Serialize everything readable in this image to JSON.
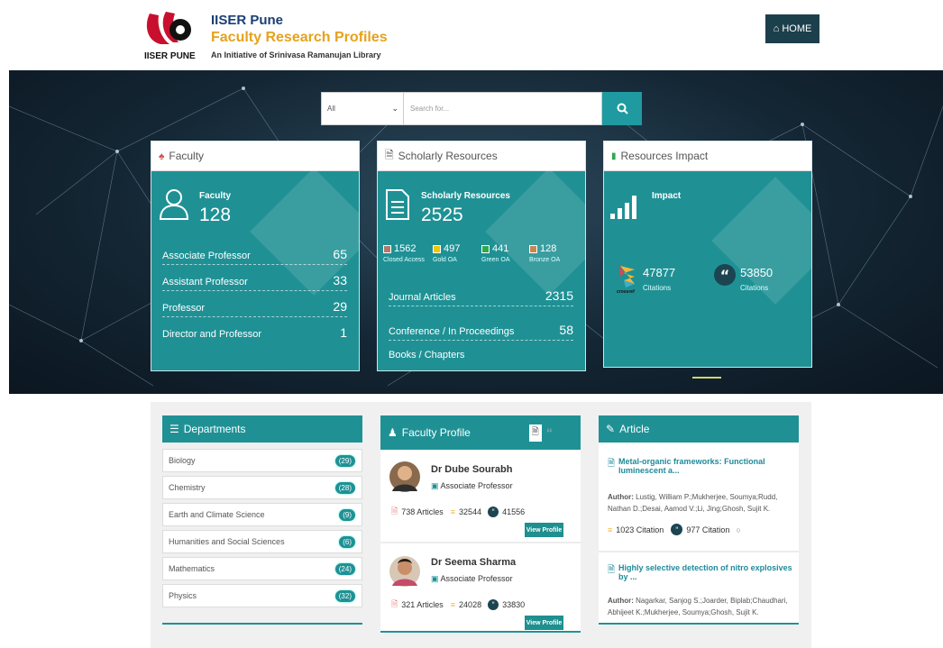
{
  "header": {
    "brand_line1": "IISER Pune",
    "brand_line2": "Faculty Research Profiles",
    "brand_line3": "An Initiative of Srinivasa Ramanujan Library",
    "logo_text": "IISER PUNE",
    "home_label": "HOME"
  },
  "search": {
    "select_value": "All",
    "placeholder": "Search for..."
  },
  "cards": {
    "faculty": {
      "header": "Faculty",
      "title": "Faculty",
      "count": "128",
      "rows": [
        {
          "label": "Associate Professor",
          "value": "65"
        },
        {
          "label": "Assistant Professor",
          "value": "33"
        },
        {
          "label": "Professor",
          "value": "29"
        },
        {
          "label": "Director and Professor",
          "value": "1"
        }
      ]
    },
    "scholarly": {
      "header": "Scholarly Resources",
      "title": "Scholarly Resources",
      "count": "2525",
      "oa": [
        {
          "value": "1562",
          "label": "Closed Access",
          "color": "#b07a6a"
        },
        {
          "value": "497",
          "label": "Gold OA",
          "color": "#f2c600"
        },
        {
          "value": "441",
          "label": "Green OA",
          "color": "#2fa84f"
        },
        {
          "value": "128",
          "label": "Bronze OA",
          "color": "#c9874f"
        }
      ],
      "rows": [
        {
          "label": "Journal Articles",
          "value": "2315"
        },
        {
          "label": "Conference / In Proceedings",
          "value": "58"
        },
        {
          "label": "Books / Chapters",
          "value": ""
        }
      ]
    },
    "impact": {
      "header": "Resources Impact",
      "title": "Impact",
      "crossref_value": "47877",
      "crossref_label": "Citations",
      "crossref_logo_text": "crossref",
      "scholar_value": "53850",
      "scholar_label": "Citations"
    }
  },
  "departments": {
    "header": "Departments",
    "items": [
      {
        "name": "Biology",
        "count": "(29)"
      },
      {
        "name": "Chemistry",
        "count": "(28)"
      },
      {
        "name": "Earth and Climate Science",
        "count": "(9)"
      },
      {
        "name": "Humanities and Social Sciences",
        "count": "(6)"
      },
      {
        "name": "Mathematics",
        "count": "(24)"
      },
      {
        "name": "Physics",
        "count": "(32)"
      }
    ]
  },
  "faculty_profile": {
    "header": "Faculty Profile",
    "people": [
      {
        "name": "Dr Dube Sourabh",
        "role": "Associate Professor",
        "articles": "738 Articles",
        "crossref": "32544",
        "scholar": "41556",
        "button": "View Profile"
      },
      {
        "name": "Dr Seema Sharma",
        "role": "Associate Professor",
        "articles": "321 Articles",
        "crossref": "24028",
        "scholar": "33830",
        "button": "View Profile"
      }
    ]
  },
  "article": {
    "header": "Article",
    "author_label": "Author:",
    "items": [
      {
        "title": "Metal-organic frameworks: Functional luminescent a...",
        "authors": "Lustig, William P.;Mukherjee, Soumya;Rudd, Nathan D.;Desai, Aamod V.;Li, Jing;Ghosh, Sujit K.",
        "crossref_citation": "1023 Citation",
        "scholar_citation": "977 Citation"
      },
      {
        "title": "Highly selective detection of nitro explosives by ...",
        "authors": "Nagarkar, Sanjog S.;Joarder, Biplab;Chaudhari, Abhijeet K.;Mukherjee, Soumya;Ghosh, Sujit K."
      }
    ]
  }
}
